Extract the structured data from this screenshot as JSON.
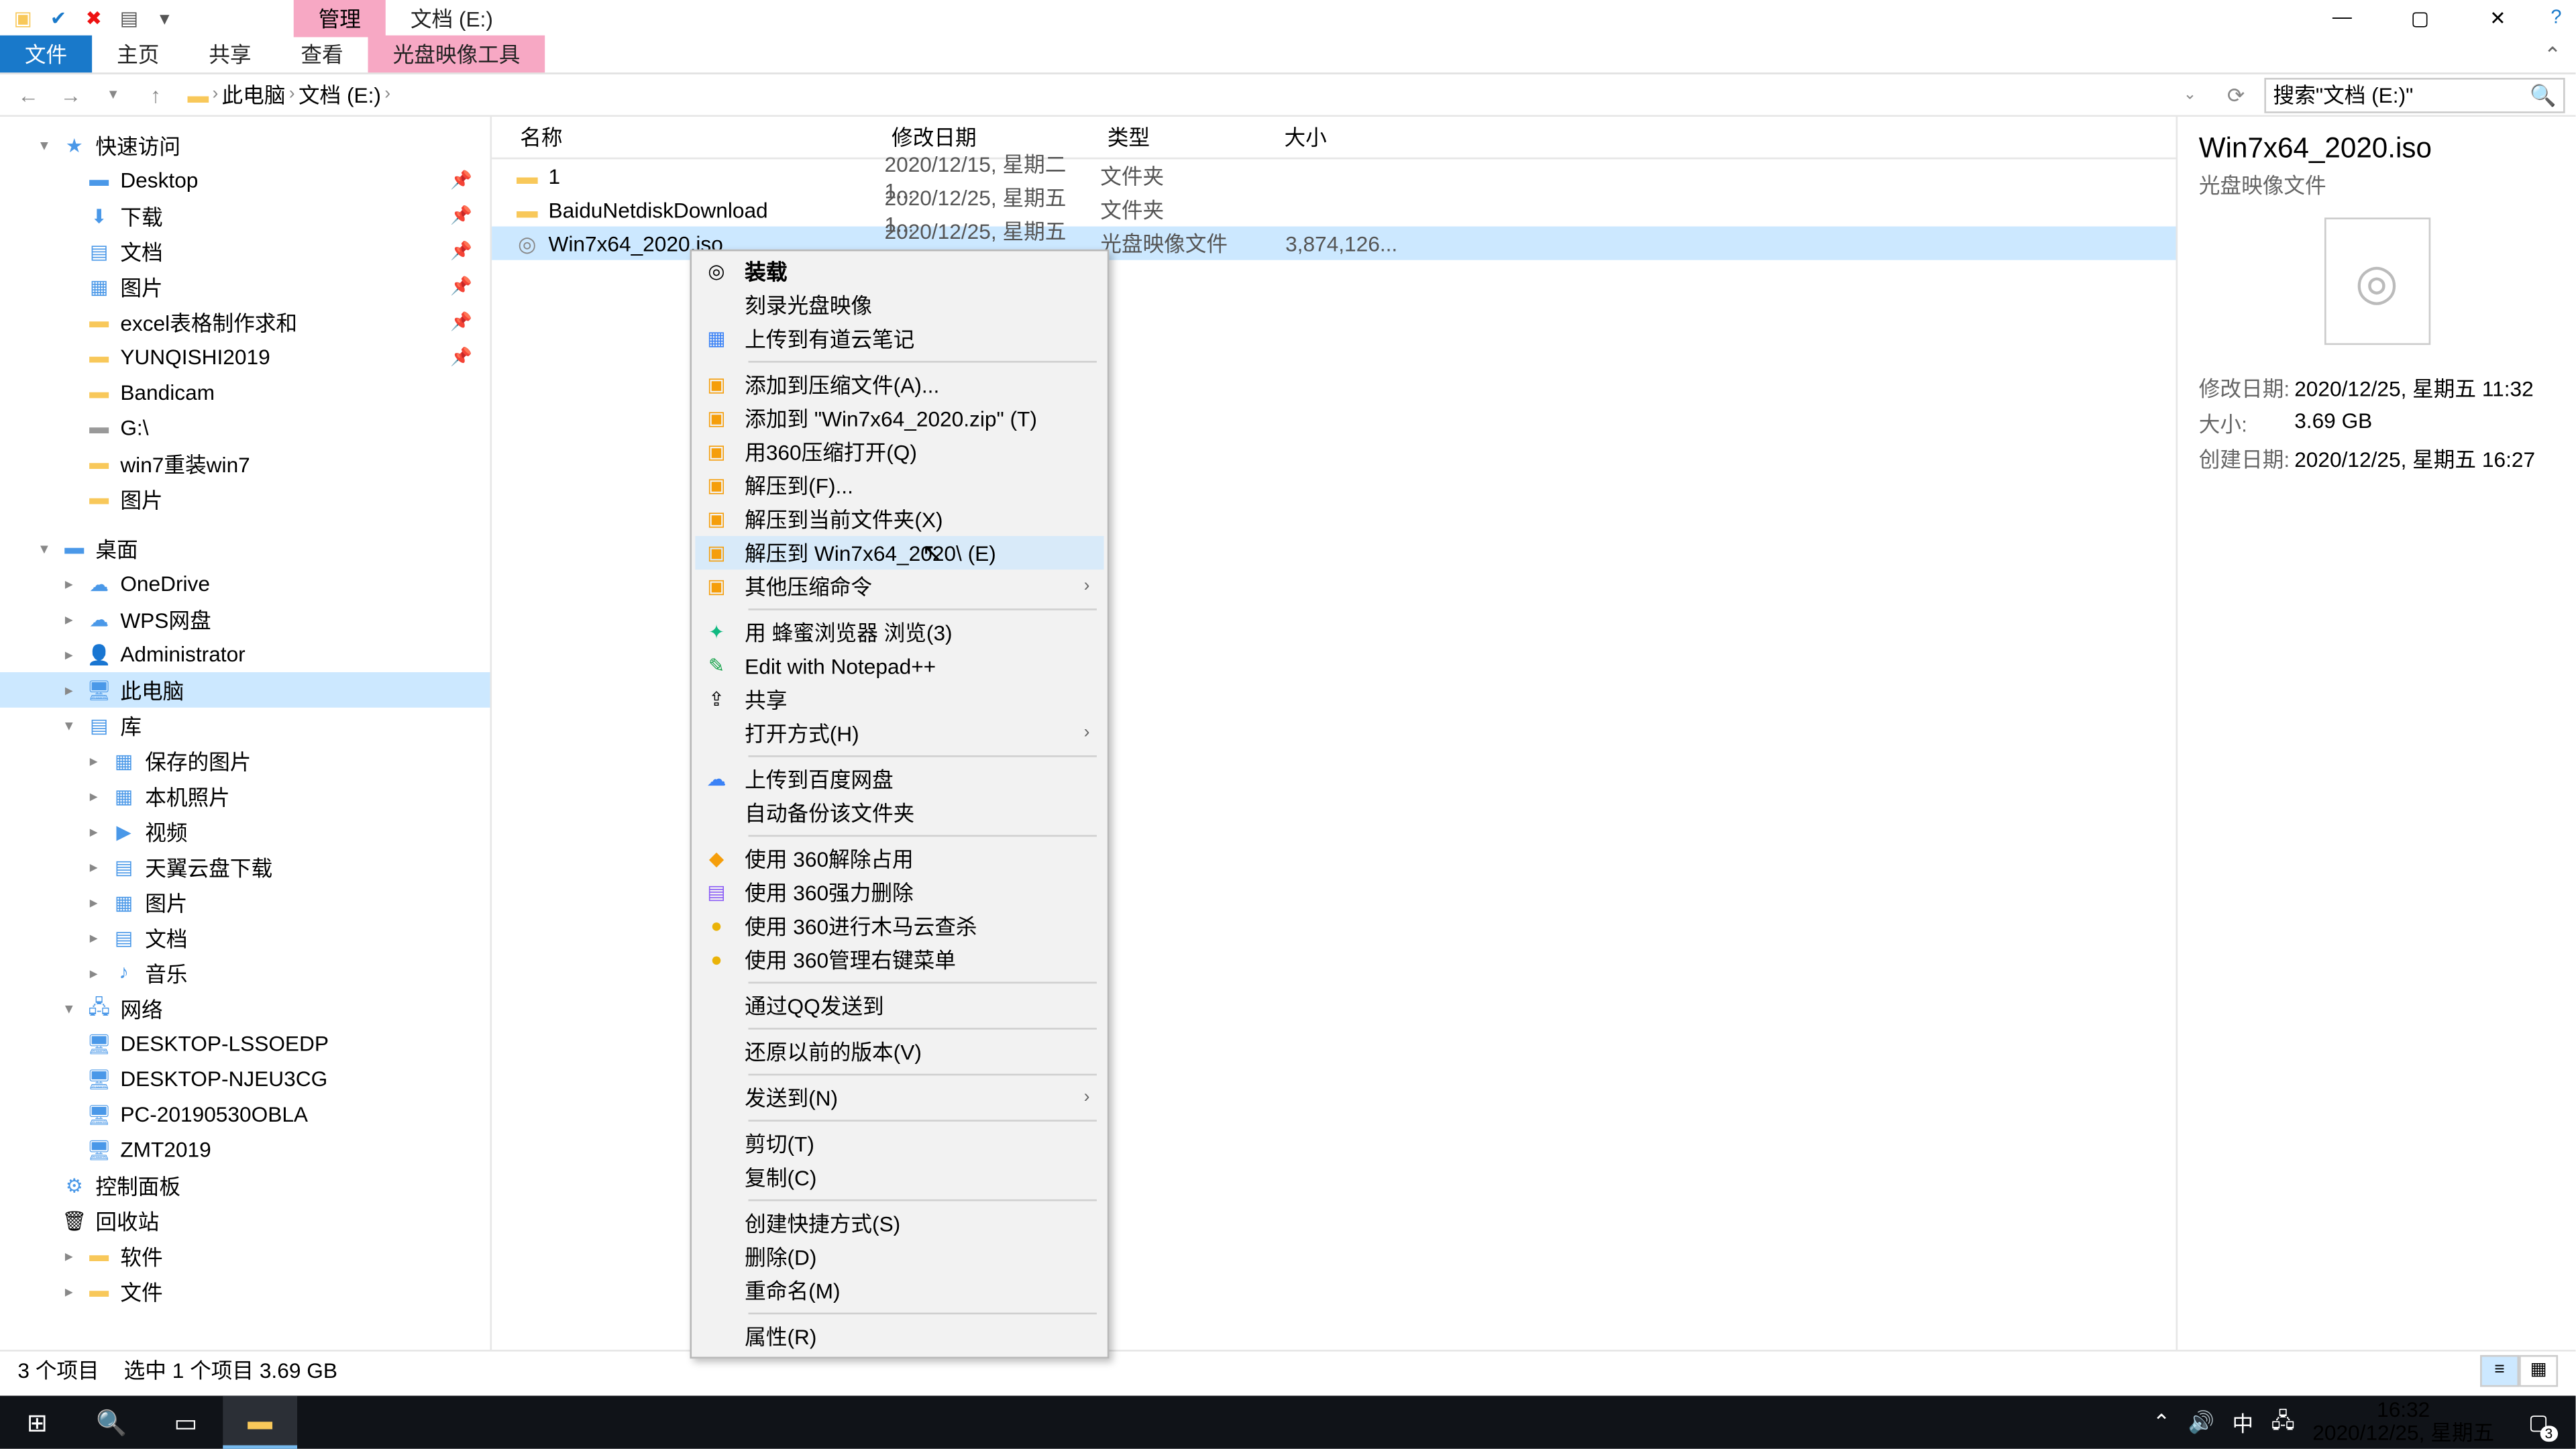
{
  "window": {
    "tab_manage": "管理",
    "tab_location": "文档 (E:)",
    "ribbon": {
      "file": "文件",
      "home": "主页",
      "share": "共享",
      "view": "查看",
      "disc": "光盘映像工具"
    }
  },
  "breadcrumb": {
    "pc": "此电脑",
    "drive": "文档 (E:)"
  },
  "search": {
    "placeholder": "搜索\"文档 (E:)\""
  },
  "tree": {
    "quick": "快速访问",
    "items_quick": [
      "Desktop",
      "下载",
      "文档",
      "图片",
      "excel表格制作求和",
      "YUNQISHI2019",
      "Bandicam",
      "G:\\",
      "win7重装win7",
      "图片"
    ],
    "desktop": "桌面",
    "items_desktop": [
      "OneDrive",
      "WPS网盘",
      "Administrator",
      "此电脑",
      "库"
    ],
    "lib_items": [
      "保存的图片",
      "本机照片",
      "视频",
      "天翼云盘下载",
      "图片",
      "文档",
      "音乐"
    ],
    "network": "网络",
    "net_items": [
      "DESKTOP-LSSOEDP",
      "DESKTOP-NJEU3CG",
      "PC-20190530OBLA",
      "ZMT2019"
    ],
    "cpanel": "控制面板",
    "recycle": "回收站",
    "soft": "软件",
    "files": "文件"
  },
  "cols": {
    "name": "名称",
    "date": "修改日期",
    "type": "类型",
    "size": "大小"
  },
  "rows": [
    {
      "name": "1",
      "date": "2020/12/15, 星期二 1...",
      "type": "文件夹",
      "size": ""
    },
    {
      "name": "BaiduNetdiskDownload",
      "date": "2020/12/25, 星期五 1...",
      "type": "文件夹",
      "size": ""
    },
    {
      "name": "Win7x64_2020.iso",
      "date": "2020/12/25, 星期五 1...",
      "type": "光盘映像文件",
      "size": "3,874,126..."
    }
  ],
  "ctx": [
    {
      "l": "装载",
      "ico": "◎",
      "bold": true
    },
    {
      "l": "刻录光盘映像"
    },
    {
      "l": "上传到有道云笔记",
      "ico": "▦",
      "ic": "#3b82f6"
    },
    {
      "sep": true
    },
    {
      "l": "添加到压缩文件(A)...",
      "ico": "▣",
      "ic": "#f59e0b"
    },
    {
      "l": "添加到 \"Win7x64_2020.zip\" (T)",
      "ico": "▣",
      "ic": "#f59e0b"
    },
    {
      "l": "用360压缩打开(Q)",
      "ico": "▣",
      "ic": "#f59e0b"
    },
    {
      "l": "解压到(F)...",
      "ico": "▣",
      "ic": "#f59e0b"
    },
    {
      "l": "解压到当前文件夹(X)",
      "ico": "▣",
      "ic": "#f59e0b"
    },
    {
      "l": "解压到 Win7x64_2020\\ (E)",
      "ico": "▣",
      "ic": "#f59e0b",
      "hi": true
    },
    {
      "l": "其他压缩命令",
      "ico": "▣",
      "ic": "#f59e0b",
      "sub": true
    },
    {
      "sep": true
    },
    {
      "l": "用 蜂蜜浏览器 浏览(3)",
      "ico": "✦",
      "ic": "#10b981"
    },
    {
      "l": "Edit with Notepad++",
      "ico": "✎",
      "ic": "#16a34a"
    },
    {
      "l": "共享",
      "ico": "⇪"
    },
    {
      "l": "打开方式(H)",
      "sub": true
    },
    {
      "sep": true
    },
    {
      "l": "上传到百度网盘",
      "ico": "☁",
      "ic": "#3b82f6"
    },
    {
      "l": "自动备份该文件夹",
      "dis": true
    },
    {
      "sep": true
    },
    {
      "l": "使用 360解除占用",
      "ico": "◆",
      "ic": "#f59e0b"
    },
    {
      "l": "使用 360强力删除",
      "ico": "▤",
      "ic": "#8b5cf6"
    },
    {
      "l": "使用 360进行木马云查杀",
      "ico": "●",
      "ic": "#eab308"
    },
    {
      "l": "使用 360管理右键菜单",
      "ico": "●",
      "ic": "#eab308"
    },
    {
      "sep": true
    },
    {
      "l": "通过QQ发送到"
    },
    {
      "sep": true
    },
    {
      "l": "还原以前的版本(V)"
    },
    {
      "sep": true
    },
    {
      "l": "发送到(N)",
      "sub": true
    },
    {
      "sep": true
    },
    {
      "l": "剪切(T)"
    },
    {
      "l": "复制(C)"
    },
    {
      "sep": true
    },
    {
      "l": "创建快捷方式(S)"
    },
    {
      "l": "删除(D)"
    },
    {
      "l": "重命名(M)"
    },
    {
      "sep": true
    },
    {
      "l": "属性(R)"
    }
  ],
  "details": {
    "title": "Win7x64_2020.iso",
    "sub": "光盘映像文件",
    "k_mod": "修改日期:",
    "v_mod": "2020/12/25, 星期五 11:32",
    "k_size": "大小:",
    "v_size": "3.69 GB",
    "k_crt": "创建日期:",
    "v_crt": "2020/12/25, 星期五 16:27"
  },
  "status": {
    "items": "3 个项目",
    "sel": "选中 1 个项目  3.69 GB"
  },
  "taskbar": {
    "time": "16:32",
    "date": "2020/12/25, 星期五",
    "badge": "3",
    "ime": "中"
  }
}
